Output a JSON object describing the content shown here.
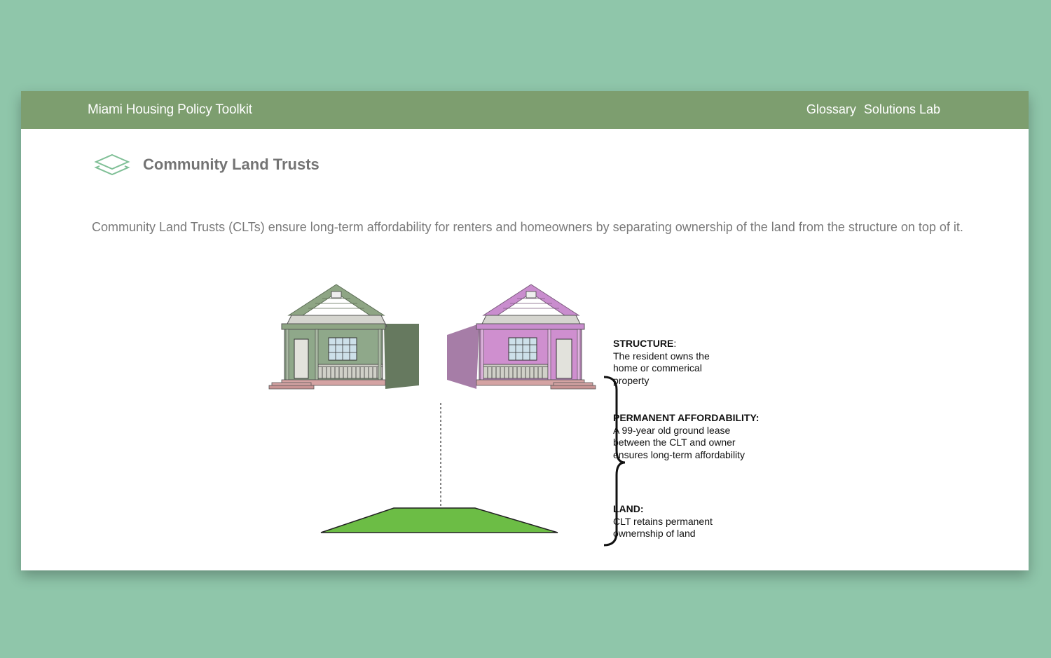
{
  "navbar": {
    "title": "Miami Housing Policy Toolkit",
    "links": [
      "Glossary",
      "Solutions Lab"
    ]
  },
  "page": {
    "icon": "layers-icon",
    "title": "Community Land Trusts",
    "intro": "Community Land Trusts (CLTs) ensure long-term affordability for renters and homeowners by separating ownership of the land from the structure on top of it."
  },
  "diagram": {
    "structure_heading": "STRUCTURE",
    "structure_colon": ":",
    "structure_text": "The resident owns the home or commerical property",
    "affordability_heading": "PERMANENT AFFORDABILITY:",
    "affordability_text": "A 99-year old ground lease between the CLT and owner ensures long-term affordability",
    "land_heading": "LAND:",
    "land_text": "CLT retains permanent ownernship of land"
  },
  "colors": {
    "background": "#8fc6aa",
    "navbar": "#7d9e6f",
    "house_left": "#8fa88a",
    "house_right": "#cf8fcf",
    "land": "#6cbd45"
  }
}
